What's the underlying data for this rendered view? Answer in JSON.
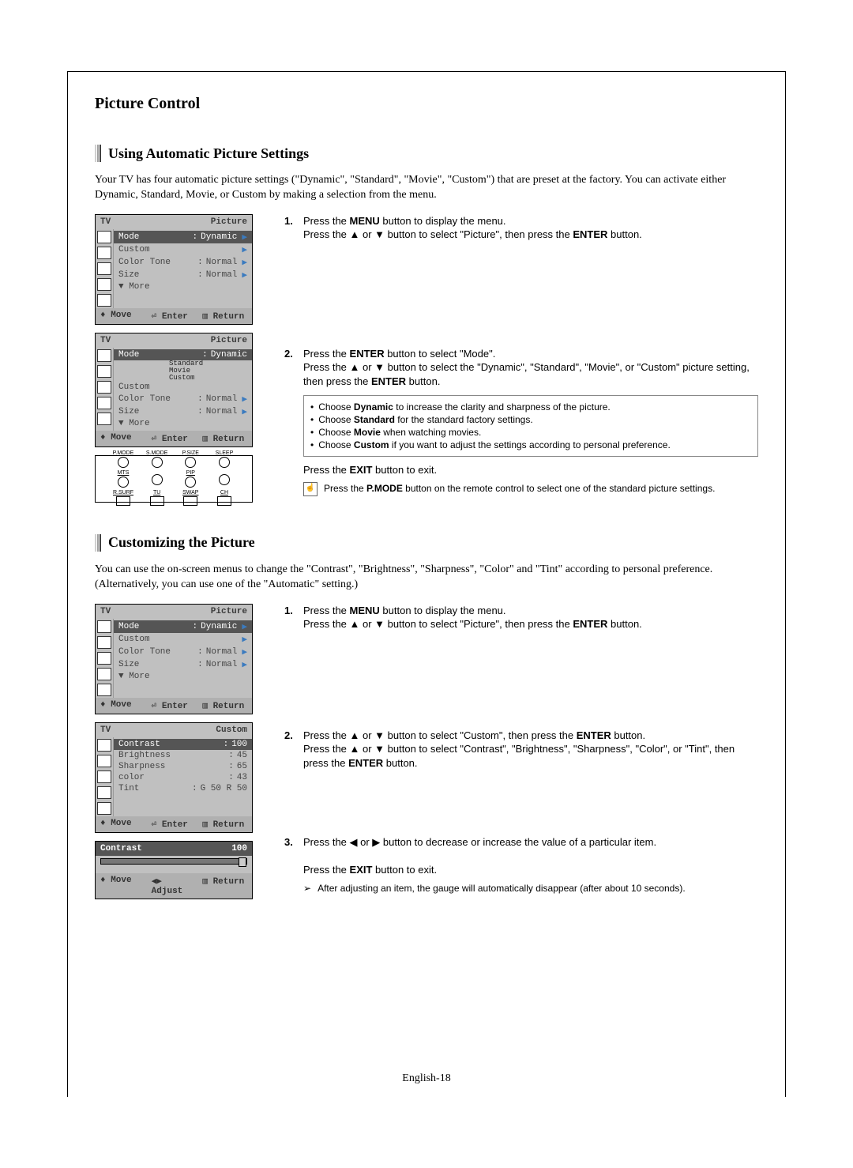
{
  "page_title": "Picture Control",
  "page_number": "English-18",
  "section1": {
    "title": "Using Automatic Picture Settings",
    "intro": "Your TV has four automatic picture settings (\"Dynamic\", \"Standard\", \"Movie\", \"Custom\") that are preset at the factory. You can activate either Dynamic, Standard, Movie, or Custom by making a selection from the menu.",
    "osd1": {
      "title_left": "TV",
      "title_right": "Picture",
      "rows": [
        {
          "label": "Mode",
          "val": "Dynamic",
          "sel": true,
          "arr": "▶"
        },
        {
          "label": "Custom",
          "val": "",
          "sel": false,
          "arr": "▶"
        },
        {
          "label": "Color Tone",
          "val": "Normal",
          "sel": false,
          "arr": "▶"
        },
        {
          "label": "Size",
          "val": "Normal",
          "sel": false,
          "arr": "▶"
        },
        {
          "label": "▼ More",
          "val": "",
          "sel": false,
          "arr": ""
        }
      ],
      "footer": {
        "move": "Move",
        "enter": "Enter",
        "return": "Return"
      }
    },
    "osd2": {
      "title_left": "TV",
      "title_right": "Picture",
      "rows": [
        {
          "label": "Mode",
          "val": "Dynamic",
          "sel": true,
          "arr": ""
        },
        {
          "label": "Custom",
          "val": "",
          "sel": false,
          "arr": ""
        },
        {
          "label": "Color Tone",
          "val": "Normal",
          "sel": false,
          "arr": "▶"
        },
        {
          "label": "Size",
          "val": "Normal",
          "sel": false,
          "arr": "▶"
        },
        {
          "label": "▼ More",
          "val": "",
          "sel": false,
          "arr": ""
        }
      ],
      "sub_list": [
        "Standard",
        "Movie",
        "Custom"
      ],
      "footer": {
        "move": "Move",
        "enter": "Enter",
        "return": "Return"
      }
    },
    "remote": {
      "top": [
        "P.MODE",
        "S.MODE",
        "P.SIZE",
        "SLEEP"
      ],
      "mid": [
        "MTS",
        "",
        "PIP",
        ""
      ],
      "bot": [
        "R.SURF",
        "TU",
        "SWAP",
        "CH"
      ]
    },
    "step1": {
      "num": "1.",
      "l1_a": "Press the ",
      "l1_b": "MENU",
      "l1_c": " button to display the menu.",
      "l2_a": "Press the ▲ or ▼ button to select \"Picture\", then press the ",
      "l2_b": "ENTER",
      "l2_c": " button."
    },
    "step2": {
      "num": "2.",
      "l1_a": "Press the ",
      "l1_b": "ENTER",
      "l1_c": " button to select \"Mode\".",
      "l2_a": "Press the ▲ or ▼ button to select the \"Dynamic\", \"Standard\", \"Movie\", or \"Custom\" picture setting, then press the ",
      "l2_b": "ENTER",
      "l2_c": " button.",
      "bul1_a": "Choose ",
      "bul1_b": "Dynamic",
      "bul1_c": " to increase the clarity and sharpness of the picture.",
      "bul2_a": "Choose ",
      "bul2_b": "Standard",
      "bul2_c": " for the standard factory settings.",
      "bul3_a": "Choose ",
      "bul3_b": "Movie",
      "bul3_c": " when watching movies.",
      "bul4_a": "Choose ",
      "bul4_b": "Custom",
      "bul4_c": " if you want to adjust the settings according to personal preference.",
      "exit_a": "Press the ",
      "exit_b": "EXIT",
      "exit_c": " button to exit.",
      "note_a": "Press the ",
      "note_b": "P.MODE",
      "note_c": " button on the remote control to select one of the standard picture settings."
    }
  },
  "section2": {
    "title": "Customizing the Picture",
    "intro": "You can use the on-screen menus to change the \"Contrast\", \"Brightness\", \"Sharpness\", \"Color\" and \"Tint\" according to personal preference. (Alternatively, you can use one of the \"Automatic\" setting.)",
    "osd1": {
      "title_left": "TV",
      "title_right": "Picture",
      "rows": [
        {
          "label": "Mode",
          "val": "Dynamic",
          "sel": true,
          "arr": "▶"
        },
        {
          "label": "Custom",
          "val": "",
          "sel": false,
          "arr": "▶"
        },
        {
          "label": "Color Tone",
          "val": "Normal",
          "sel": false,
          "arr": "▶"
        },
        {
          "label": "Size",
          "val": "Normal",
          "sel": false,
          "arr": "▶"
        },
        {
          "label": "▼ More",
          "val": "",
          "sel": false,
          "arr": ""
        }
      ],
      "footer": {
        "move": "Move",
        "enter": "Enter",
        "return": "Return"
      }
    },
    "osd2": {
      "title_left": "TV",
      "title_right": "Custom",
      "rows": [
        {
          "label": "Contrast",
          "val": "100",
          "sel": true,
          "arr": ""
        },
        {
          "label": "Brightness",
          "val": "45",
          "sel": false,
          "arr": ""
        },
        {
          "label": "Sharpness",
          "val": "65",
          "sel": false,
          "arr": ""
        },
        {
          "label": "color",
          "val": "43",
          "sel": false,
          "arr": ""
        },
        {
          "label": "Tint",
          "val": "G 50 R 50",
          "sel": false,
          "arr": ""
        }
      ],
      "footer": {
        "move": "Move",
        "enter": "Enter",
        "return": "Return"
      }
    },
    "osd3": {
      "title_left": "Contrast",
      "title_right": "100",
      "footer": {
        "move": "Move",
        "adjust": "Adjust",
        "return": "Return"
      }
    },
    "step1": {
      "num": "1.",
      "l1_a": "Press the ",
      "l1_b": "MENU",
      "l1_c": " button to display the menu.",
      "l2_a": "Press the ▲ or ▼ button to select \"Picture\", then press the ",
      "l2_b": "ENTER",
      "l2_c": " button."
    },
    "step2": {
      "num": "2.",
      "l1_a": "Press the ▲ or ▼ button to select \"Custom\", then press the ",
      "l1_b": "ENTER",
      "l1_c": " button.",
      "l2_a": "Press the ▲ or ▼ button to select \"Contrast\", \"Brightness\", \"Sharpness\", \"Color\", or \"Tint\", then press the ",
      "l2_b": "ENTER",
      "l2_c": " button."
    },
    "step3": {
      "num": "3.",
      "l1": "Press the ◀ or ▶ button to decrease or increase the value of a particular item.",
      "exit_a": "Press the ",
      "exit_b": "EXIT",
      "exit_c": " button to exit.",
      "note": "After adjusting an item, the gauge will automatically disappear (after about 10 seconds)."
    }
  }
}
